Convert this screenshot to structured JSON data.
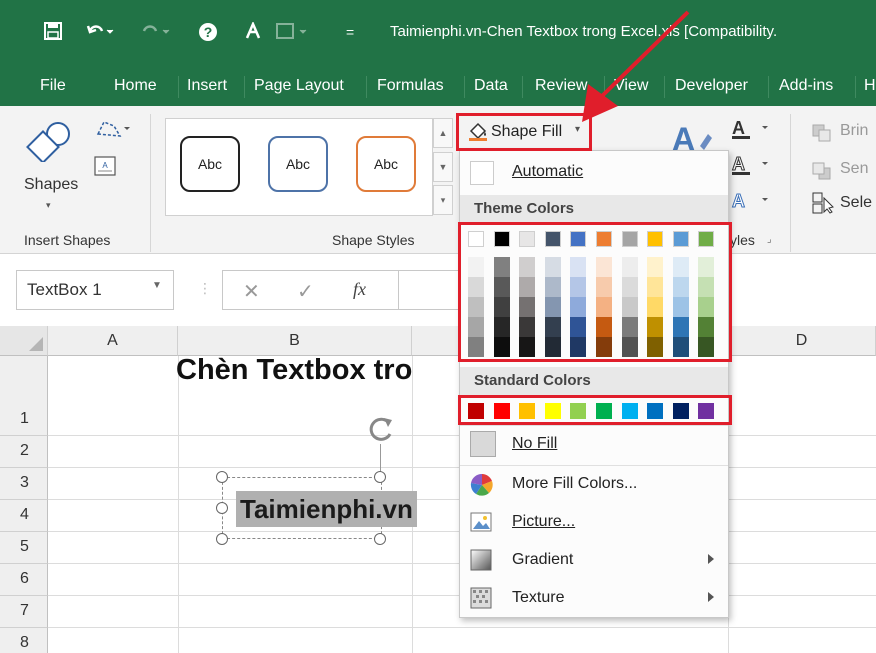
{
  "window": {
    "title": "Taimienphi.vn-Chen Textbox trong Excel.xls  [Compatibility.",
    "qat_customize_symbol": "="
  },
  "tabs": [
    "File",
    "Home",
    "Insert",
    "Page Layout",
    "Formulas",
    "Data",
    "Review",
    "View",
    "Developer",
    "Add-ins",
    "H"
  ],
  "ribbon": {
    "insert_shapes": {
      "shapes_label": "Shapes",
      "group_label": "Insert Shapes"
    },
    "shape_styles": {
      "gallery": [
        "Abc",
        "Abc",
        "Abc"
      ],
      "group_label": "Shape Styles",
      "gallery_border_colors": [
        "#222222",
        "#4e73a8",
        "#e07b39"
      ]
    },
    "shape_fill_label": "Shape Fill",
    "wordart_group_label_fragment": "yles",
    "arrange": {
      "items": [
        "Brin",
        "Sen",
        "Sele"
      ]
    }
  },
  "formula_bar": {
    "name_box": "TextBox 1",
    "fx": "fx"
  },
  "sheet": {
    "columns": [
      "A",
      "B",
      "D"
    ],
    "rows": [
      "1",
      "2",
      "3",
      "4",
      "5",
      "6",
      "7",
      "8"
    ],
    "title_text": "Chèn Textbox tro",
    "textbox_text": "Taimienphi.vn"
  },
  "menu": {
    "automatic_label": "Automatic",
    "theme_colors_label": "Theme Colors",
    "standard_colors_label": "Standard Colors",
    "no_fill_label": "No Fill",
    "more_fill_colors_label": "More Fill Colors...",
    "picture_label": "Picture...",
    "gradient_label": "Gradient",
    "texture_label": "Texture",
    "theme_top_row": [
      "#ffffff",
      "#000000",
      "#e7e6e6",
      "#44546a",
      "#4472c4",
      "#ed7d31",
      "#a5a5a5",
      "#ffc000",
      "#5b9bd5",
      "#70ad47"
    ],
    "theme_shades": [
      [
        "#f2f2f2",
        "#d9d9d9",
        "#bfbfbf",
        "#a6a6a6",
        "#808080"
      ],
      [
        "#808080",
        "#595959",
        "#404040",
        "#262626",
        "#0d0d0d"
      ],
      [
        "#d0cece",
        "#aeaaaa",
        "#757171",
        "#3a3838",
        "#171616"
      ],
      [
        "#d6dce4",
        "#adb9ca",
        "#8496b0",
        "#333f4f",
        "#222a35"
      ],
      [
        "#d9e2f3",
        "#b4c6e7",
        "#8eaadb",
        "#2f5496",
        "#1f3864"
      ],
      [
        "#fbe5d5",
        "#f7cbac",
        "#f4b183",
        "#c55a11",
        "#843c0b"
      ],
      [
        "#ededed",
        "#dbdbdb",
        "#c9c9c9",
        "#7b7b7b",
        "#525252"
      ],
      [
        "#fff2cc",
        "#ffe599",
        "#ffd966",
        "#bf9000",
        "#7f6000"
      ],
      [
        "#deebf6",
        "#bdd7ee",
        "#9dc3e6",
        "#2e75b5",
        "#1f4e79"
      ],
      [
        "#e2efd9",
        "#c5e0b3",
        "#a8d08d",
        "#538135",
        "#375623"
      ]
    ],
    "standard": [
      "#c00000",
      "#ff0000",
      "#ffc000",
      "#ffff00",
      "#92d050",
      "#00b050",
      "#00b0f0",
      "#0070c0",
      "#002060",
      "#7030a0"
    ]
  },
  "colors": {
    "excel_green": "#217346",
    "highlight_red": "#e01e2b"
  }
}
